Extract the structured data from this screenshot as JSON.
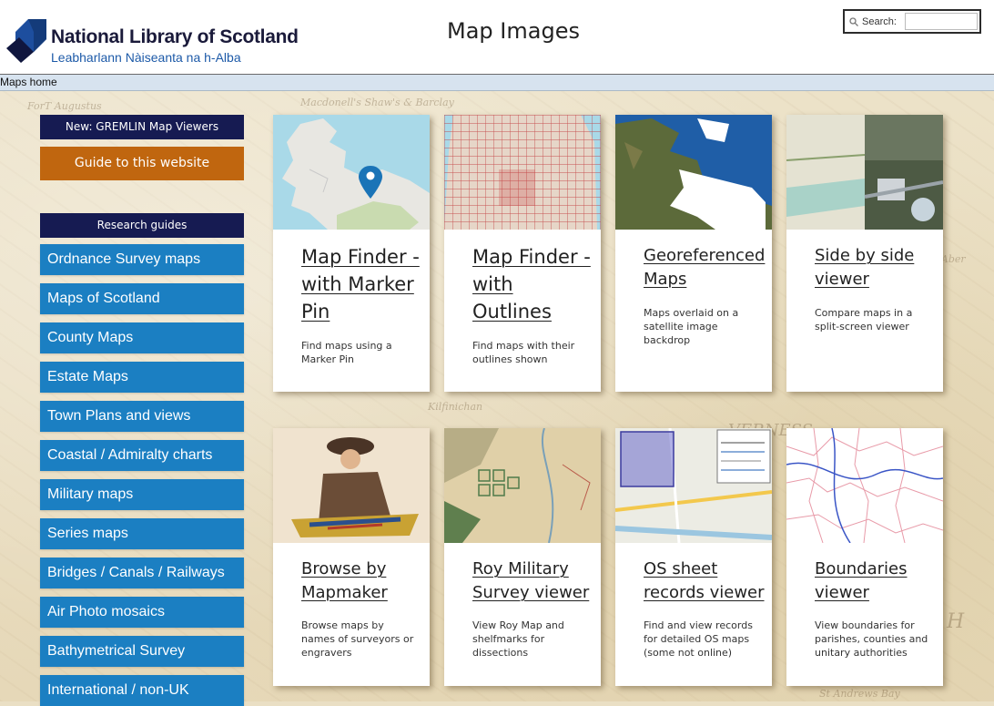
{
  "header": {
    "logo_line1": "National Library of Scotland",
    "logo_line2": "Leabharlann Nàiseanta na h-Alba",
    "page_title": "Map Images",
    "search_label": "Search:",
    "search_value": ""
  },
  "breadcrumb": {
    "home": "Maps home"
  },
  "sidebar": {
    "top": [
      {
        "label": "New: GREMLIN Map Viewers"
      },
      {
        "label": "Guide to this website"
      }
    ],
    "research_header": "Research guides",
    "items": [
      {
        "label": "Ordnance Survey maps"
      },
      {
        "label": "Maps of Scotland"
      },
      {
        "label": "County Maps"
      },
      {
        "label": "Estate Maps"
      },
      {
        "label": "Town Plans and views"
      },
      {
        "label": "Coastal / Admiralty charts"
      },
      {
        "label": "Military maps"
      },
      {
        "label": "Series maps"
      },
      {
        "label": "Bridges / Canals / Railways"
      },
      {
        "label": "Air Photo mosaics"
      },
      {
        "label": "Bathymetrical Survey"
      },
      {
        "label": "International / non-UK"
      }
    ]
  },
  "cards": [
    {
      "title": "Map Finder - with Marker Pin",
      "desc": "Find maps using a Marker Pin"
    },
    {
      "title": "Map Finder - with Outlines",
      "desc": "Find maps with their outlines shown"
    },
    {
      "title": "Georeferenced Maps",
      "desc": "Maps overlaid on a satellite image backdrop"
    },
    {
      "title": "Side by side viewer",
      "desc": "Compare maps in a split-screen viewer"
    },
    {
      "title": "Browse by Mapmaker",
      "desc": "Browse maps by names of surveyors or engravers"
    },
    {
      "title": "Roy Military Survey viewer",
      "desc": "View Roy Map and shelfmarks for dissections"
    },
    {
      "title": "OS sheet records viewer",
      "desc": "Find and view records for detailed OS maps (some not online)"
    },
    {
      "title": "Boundaries viewer",
      "desc": "View boundaries for parishes, counties and unitary authorities"
    }
  ],
  "colors": {
    "sidebar_dark": "#161b52",
    "sidebar_orange": "#c0660f",
    "sidebar_blue": "#1b7fc2",
    "logo_blue": "#1d5aa8"
  }
}
